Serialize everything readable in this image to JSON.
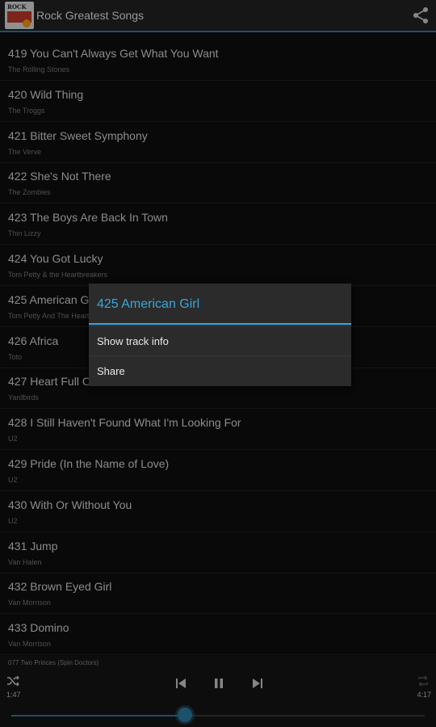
{
  "app": {
    "title": "Rock Greatest Songs",
    "logo_text": "ROCK"
  },
  "songs": [
    {
      "title": "419 You Can't Always Get What You Want",
      "artist": "The Rolling Stones"
    },
    {
      "title": "420 Wild Thing",
      "artist": "The Troggs"
    },
    {
      "title": "421 Bitter Sweet Symphony",
      "artist": "The Verve"
    },
    {
      "title": "422 She's Not There",
      "artist": "The Zombies"
    },
    {
      "title": "423 The Boys Are Back In Town",
      "artist": "Thin Lizzy"
    },
    {
      "title": "424 You Got Lucky",
      "artist": "Tom Petty & the Heartbreakers"
    },
    {
      "title": "425 American Girl",
      "artist": "Tom Petty And The Heartbreakers"
    },
    {
      "title": "426 Africa",
      "artist": "Toto"
    },
    {
      "title": "427 Heart Full Of Soul",
      "artist": "Yardbirds"
    },
    {
      "title": "428 I Still Haven't Found What I'm Looking For",
      "artist": "U2"
    },
    {
      "title": "429 Pride (In the Name of Love)",
      "artist": "U2"
    },
    {
      "title": "430 With Or Without You",
      "artist": "U2"
    },
    {
      "title": "431 Jump",
      "artist": "Van Halen"
    },
    {
      "title": "432 Brown Eyed Girl",
      "artist": "Van Morrison"
    },
    {
      "title": "433 Domino",
      "artist": "Van Morrison"
    }
  ],
  "player": {
    "now_playing": "077 Two Princes (Spin Doctors)",
    "elapsed": "1:47",
    "duration": "4:17",
    "progress": 0.42
  },
  "dialog": {
    "title": "425 American Girl",
    "items": [
      "Show track info",
      "Share"
    ]
  },
  "colors": {
    "accent": "#3aa6d9",
    "appbar": "#222222",
    "background": "#0e0e0e"
  }
}
